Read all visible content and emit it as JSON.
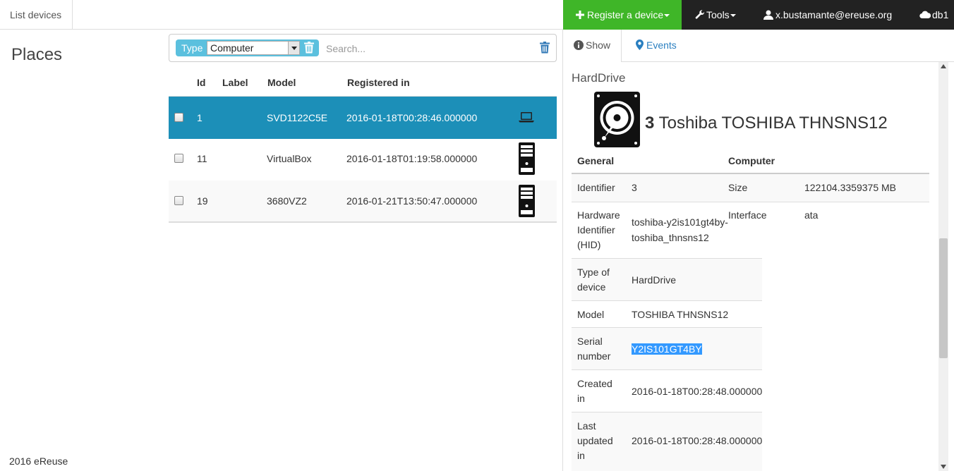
{
  "nav": {
    "list_devices": "List devices",
    "register": "Register a device",
    "tools": "Tools",
    "user": "x.bustamante@ereuse.org",
    "db": "db1"
  },
  "left": {
    "places_title": "Places",
    "footer": "2016 eReuse"
  },
  "search": {
    "type_label": "Type",
    "type_value": "Computer",
    "placeholder": "Search..."
  },
  "table": {
    "headers": {
      "id": "Id",
      "label": "Label",
      "model": "Model",
      "registered": "Registered in"
    },
    "rows": [
      {
        "id": "1",
        "label": "",
        "model": "SVD1122C5E",
        "registered": "2016-01-18T00:28:46.000000",
        "icon": "laptop-icon",
        "selected": true
      },
      {
        "id": "11",
        "label": "",
        "model": "VirtualBox",
        "registered": "2016-01-18T01:19:58.000000",
        "icon": "desktop-tower-icon",
        "selected": false
      },
      {
        "id": "19",
        "label": "",
        "model": "3680VZ2",
        "registered": "2016-01-21T13:50:47.000000",
        "icon": "desktop-tower-icon",
        "selected": false
      }
    ]
  },
  "detail": {
    "tabs": {
      "show": "Show",
      "events": "Events"
    },
    "kind": "HardDrive",
    "title_id": "3",
    "title_name": "Toshiba TOSHIBA THNSNS12",
    "headers": {
      "general": "General",
      "computer": "Computer"
    },
    "identifier_label": "Identifier",
    "identifier_value": "3",
    "size_label": "Size",
    "size_value": "122104.3359375 MB",
    "hid_label_1": "Hardware",
    "hid_label_2": "Identifier",
    "hid_label_3": "(HID)",
    "hid_value_1": "toshiba-y2is101gt4by-",
    "hid_value_2": "toshiba_thnsns12",
    "interface_label": "Interface",
    "interface_value": "ata",
    "type_label_1": "Type of",
    "type_label_2": "device",
    "type_value": "HardDrive",
    "model_label": "Model",
    "model_value": "TOSHIBA THNSNS12",
    "serial_label_1": "Serial",
    "serial_label_2": "number",
    "serial_value": "Y2IS101GT4BY",
    "created_label_1": "Created",
    "created_label_2": "in",
    "created_value": "2016-01-18T00:28:48.000000",
    "updated_label_1": "Last",
    "updated_label_2": "updated",
    "updated_label_3": "in",
    "updated_value": "2016-01-18T00:28:48.000000"
  },
  "colors": {
    "register_green": "#3fb628",
    "dark_nav": "#222222",
    "selected_row": "#1c8fb8",
    "type_tag": "#5bc0de",
    "link_blue": "#2a7fc0"
  }
}
